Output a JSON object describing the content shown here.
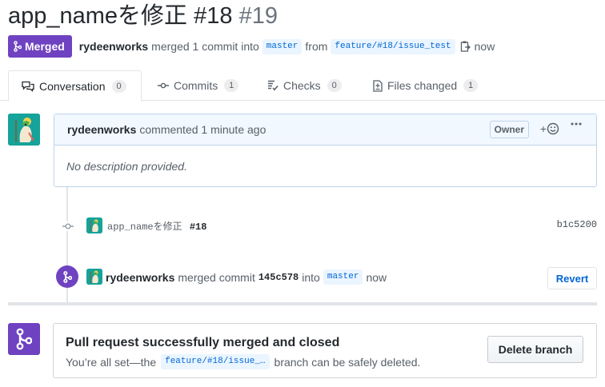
{
  "pr": {
    "title": "app_nameを修正",
    "issue_ref": "#18",
    "number": "#19",
    "state": "Merged",
    "author": "rydeenworks",
    "summary_pre": "merged 1 commit into",
    "base_branch": "master",
    "summary_mid": "from",
    "head_branch": "feature/#18/issue_test",
    "time": "now"
  },
  "tabs": [
    {
      "label": "Conversation",
      "count": "0",
      "icon": "comment-discussion-icon"
    },
    {
      "label": "Commits",
      "count": "1",
      "icon": "git-commit-icon"
    },
    {
      "label": "Checks",
      "count": "0",
      "icon": "checklist-icon"
    },
    {
      "label": "Files changed",
      "count": "1",
      "icon": "file-diff-icon"
    }
  ],
  "comment": {
    "author": "rydeenworks",
    "action": "commented 1 minute ago",
    "role": "Owner",
    "reaction_plus": "+",
    "body": "No description provided."
  },
  "commit": {
    "message": "app_nameを修正",
    "issue": "#18",
    "sha": "b1c5200"
  },
  "merge_event": {
    "author": "rydeenworks",
    "action": "merged commit",
    "sha": "145c578",
    "into": "into",
    "branch": "master",
    "time": "now",
    "revert_label": "Revert"
  },
  "merge_box": {
    "title": "Pull request successfully merged and closed",
    "desc_pre": "You’re all set—the",
    "branch": "feature/#18/issue_…",
    "desc_post": "branch can be safely deleted.",
    "delete_label": "Delete branch"
  },
  "colors": {
    "merged_purple": "#6f42c1",
    "link_blue": "#0366d6",
    "avatar_teal": "#15a39a"
  }
}
